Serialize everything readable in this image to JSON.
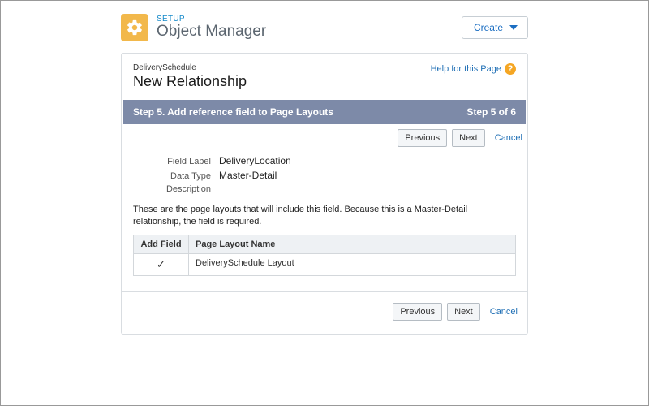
{
  "header": {
    "eyebrow": "SETUP",
    "title": "Object Manager",
    "create_label": "Create"
  },
  "page": {
    "object_name": "DeliverySchedule",
    "title": "New Relationship",
    "help_text": "Help for this Page"
  },
  "step": {
    "title": "Step 5. Add reference field to Page Layouts",
    "progress": "Step 5 of 6"
  },
  "buttons": {
    "previous": "Previous",
    "next": "Next",
    "cancel": "Cancel"
  },
  "field_info": {
    "field_label_label": "Field Label",
    "field_label_value": "DeliveryLocation",
    "data_type_label": "Data Type",
    "data_type_value": "Master-Detail",
    "description_label": "Description",
    "description_value": ""
  },
  "note": "These are the page layouts that will include this field. Because this is a Master-Detail relationship, the field is required.",
  "table": {
    "col_add": "Add Field",
    "col_name": "Page Layout Name",
    "rows": [
      {
        "checked": true,
        "name": "DeliverySchedule Layout"
      }
    ]
  }
}
